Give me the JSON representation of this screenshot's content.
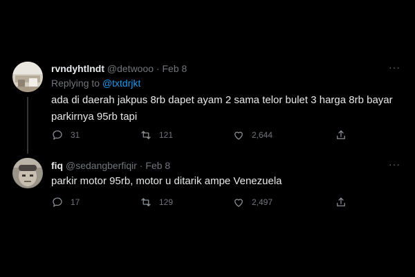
{
  "tweets": [
    {
      "name": "rvndyhtlndt",
      "handle": "@detwooo",
      "separator": "·",
      "date": "Feb 8",
      "replying_prefix": "Replying to",
      "replying_to": "@txtdrjkt",
      "text_line1": "ada di daerah jakpus 8rb dapet ayam 2 sama telor bulet 3 harga 8rb bayar",
      "text_line2": "parkirnya 95rb tapi",
      "replies": "31",
      "retweets": "121",
      "likes": "2,644",
      "more": "···"
    },
    {
      "name": "fiq",
      "handle": "@sedangberfiqir",
      "separator": "·",
      "date": "Feb 8",
      "text_line1": "parkir motor 95rb, motor u ditarik ampe Venezuela",
      "replies": "17",
      "retweets": "129",
      "likes": "2,497",
      "more": "···"
    }
  ],
  "colors": {
    "background": "#000000",
    "text": "#e7e9ea",
    "muted": "#71767b",
    "link": "#1d9bf0"
  },
  "icons": [
    "reply-icon",
    "retweet-icon",
    "like-icon",
    "share-icon",
    "more-icon"
  ]
}
